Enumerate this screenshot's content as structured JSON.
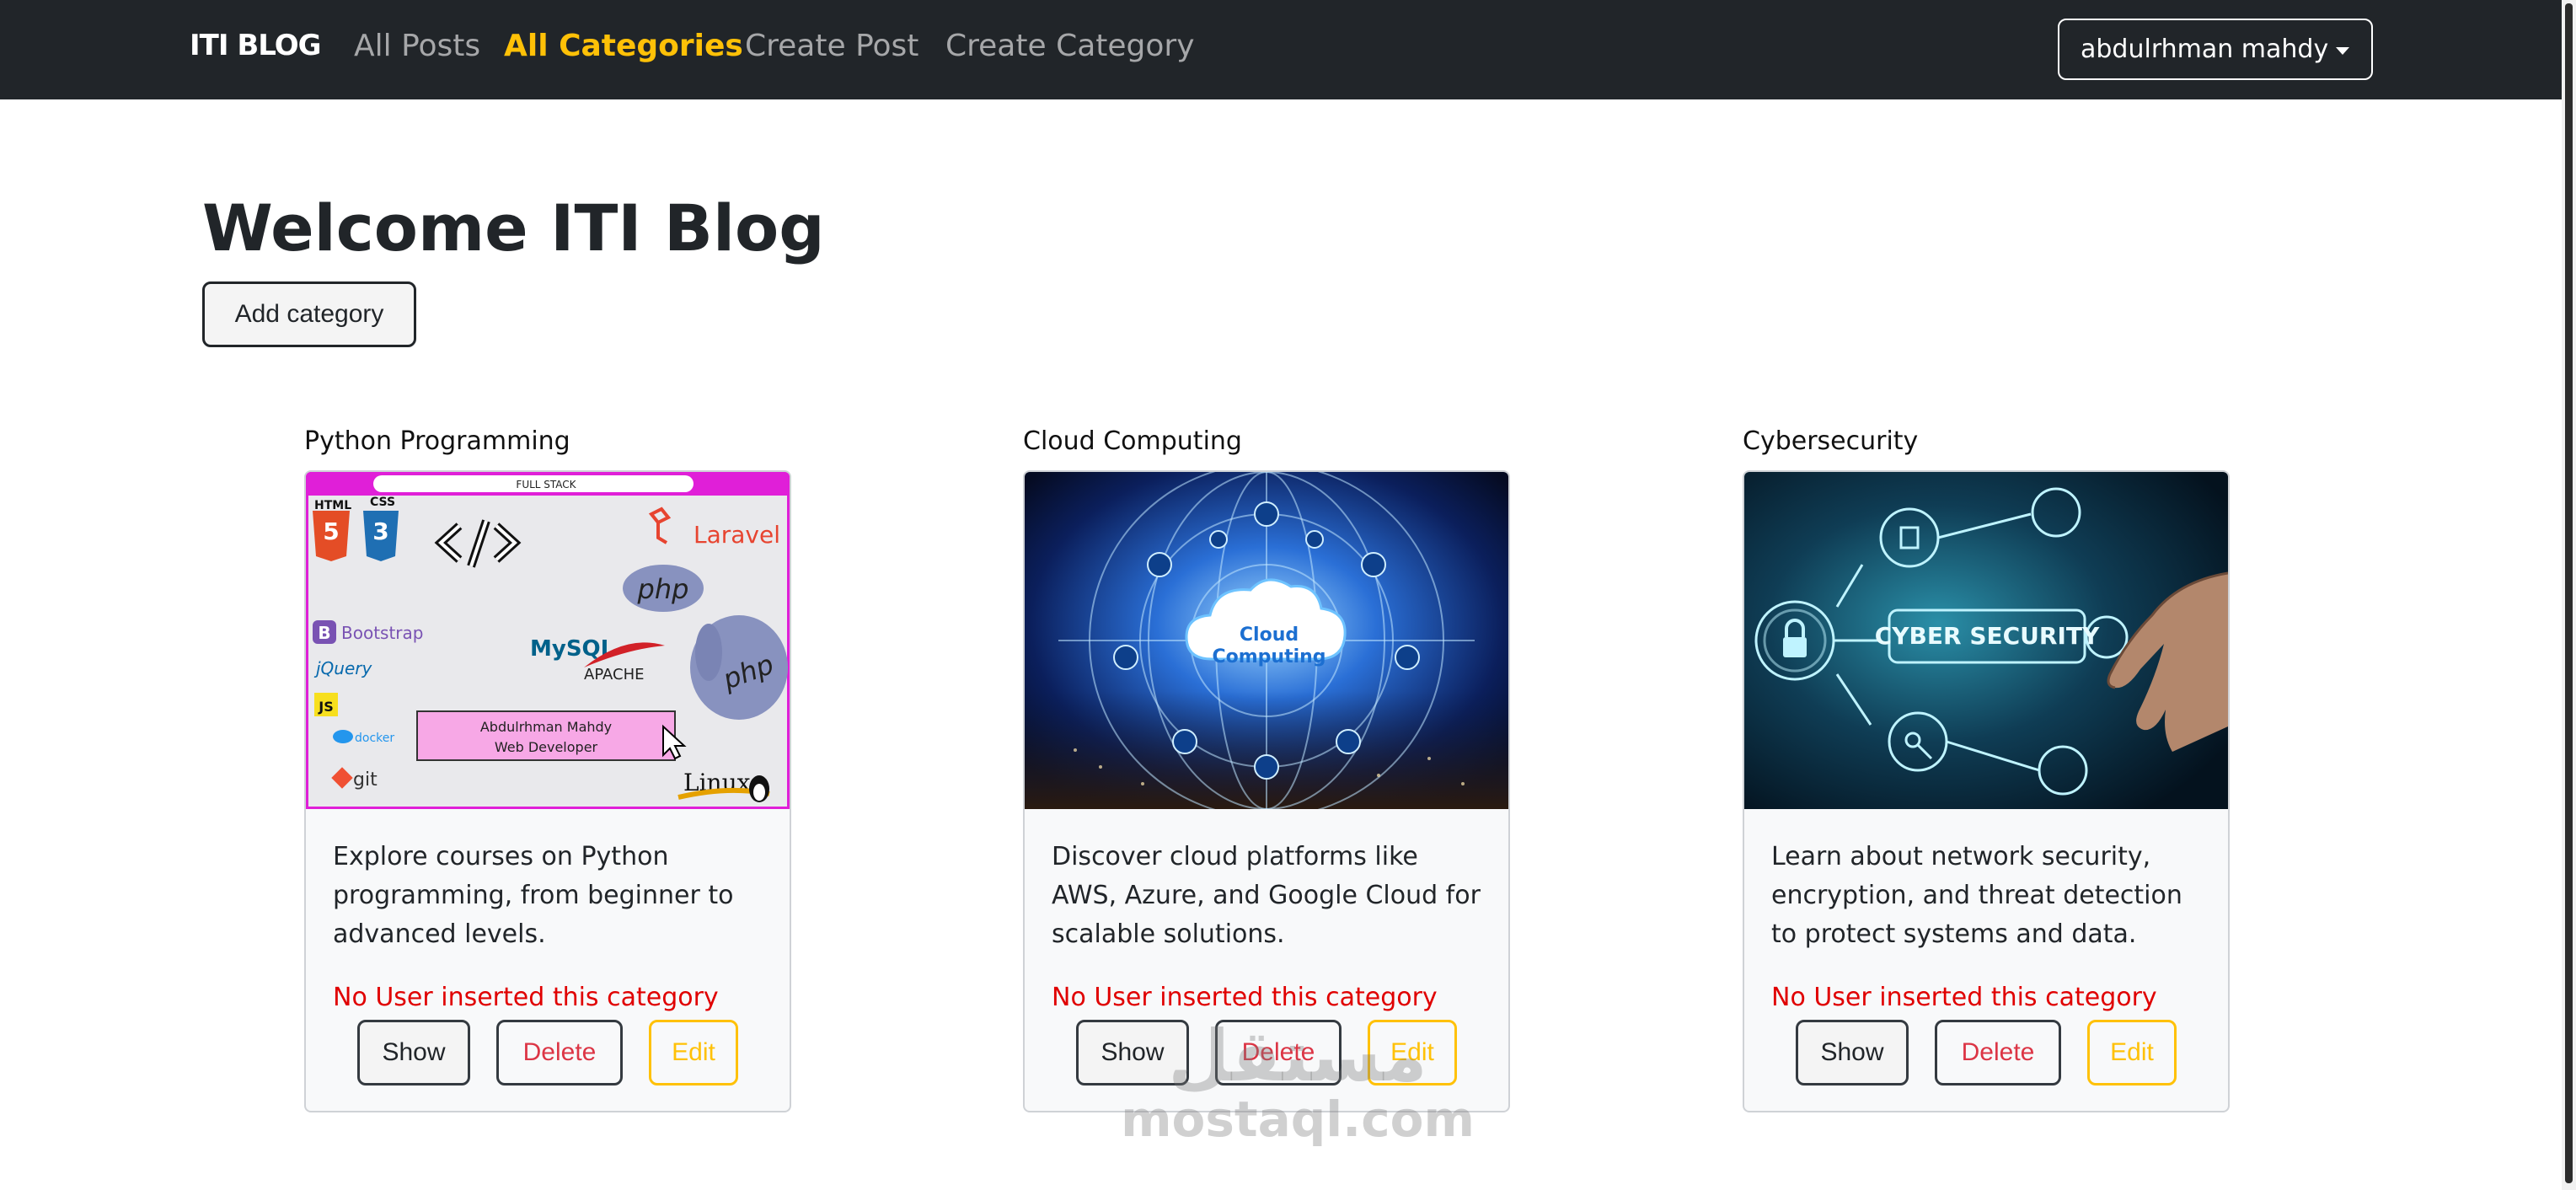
{
  "navbar": {
    "brand": "ITI BLOG",
    "links": [
      {
        "label": "All Posts",
        "active": false
      },
      {
        "label": "All Categories",
        "active": true
      },
      {
        "label": "Create Post",
        "active": false
      },
      {
        "label": "Create Category",
        "active": false
      }
    ],
    "user_menu": "abdulrhman mahdy"
  },
  "main": {
    "title": "Welcome ITI Blog",
    "add_button": "Add category"
  },
  "categories": [
    {
      "title": "Python Programming",
      "image_icon": "web-technologies-collage",
      "image_text": {
        "url_bar": "FULL STACK",
        "html": "HTML",
        "css": "CSS",
        "laravel": "Laravel",
        "php": "php",
        "bootstrap": "Bootstrap",
        "mysql": "MySQL",
        "apache": "APACHE",
        "jquery": "jQuery",
        "js": "JS",
        "docker": "docker",
        "banner_line1": "Abdulrhman Mahdy",
        "banner_line2": "Web Developer",
        "git": "git",
        "linux": "Linux"
      },
      "description": "Explore courses on Python programming, from beginner to advanced levels.",
      "owner": "No User inserted this category",
      "buttons": {
        "show": "Show",
        "delete": "Delete",
        "edit": "Edit"
      }
    },
    {
      "title": "Cloud Computing",
      "image_icon": "cloud-network-globe",
      "image_text": {
        "line1": "Cloud",
        "line2": "Computing"
      },
      "description": "Discover cloud platforms like AWS, Azure, and Google Cloud for scalable solutions.",
      "owner": "No User inserted this category",
      "buttons": {
        "show": "Show",
        "delete": "Delete",
        "edit": "Edit"
      }
    },
    {
      "title": "Cybersecurity",
      "image_icon": "cyber-security-hud",
      "image_text": {
        "label": "CYBER SECURITY"
      },
      "description": "Learn about network security, encryption, and threat detection to protect systems and data.",
      "owner": "No User inserted this category",
      "buttons": {
        "show": "Show",
        "delete": "Delete",
        "edit": "Edit"
      }
    }
  ],
  "watermark": {
    "arabic": "مستقل",
    "latin": "mostaql.com"
  },
  "colors": {
    "navbar_bg": "#212529",
    "active_link": "#ffc107",
    "danger": "#dc3545",
    "owner_text": "#e00000",
    "warning": "#ffc107"
  }
}
